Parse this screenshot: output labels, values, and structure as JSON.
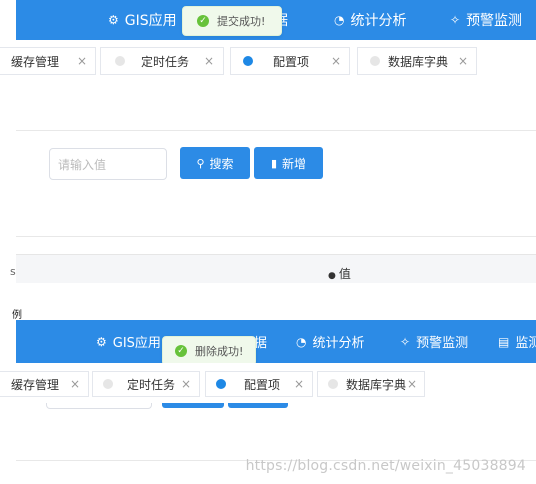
{
  "screen1": {
    "nav": [
      {
        "icon": "⚙",
        "label": "GIS应用"
      },
      {
        "icon": "",
        "label": "据"
      },
      {
        "icon": "◔",
        "label": "统计分析"
      },
      {
        "icon": "✧",
        "label": "预警监测"
      }
    ],
    "toast": "提交成功!",
    "tabs": [
      {
        "label": "缓存管理",
        "close": "×",
        "active": false
      },
      {
        "label": "定时任务",
        "close": "×",
        "active": false
      },
      {
        "label": "配置项",
        "close": "×",
        "active": true
      },
      {
        "label": "数据库字典",
        "close": "×",
        "active": false
      }
    ],
    "search_placeholder": "请输入值",
    "search_button": "搜索",
    "add_button": "新增",
    "table_header_left": "s",
    "table_header_value": "值",
    "table_header_value_icon": "●"
  },
  "separator_label": "例",
  "screen2": {
    "nav": [
      {
        "icon": "⚙",
        "label": "GIS应用"
      },
      {
        "icon": "",
        "label": "据"
      },
      {
        "icon": "◔",
        "label": "统计分析"
      },
      {
        "icon": "✧",
        "label": "预警监测"
      },
      {
        "icon": "▤",
        "label": "监测"
      }
    ],
    "toast": "删除成功!",
    "tabs": [
      {
        "label": "缓存管理",
        "close": "×",
        "active": false
      },
      {
        "label": "定时任务",
        "close": "×",
        "active": false
      },
      {
        "label": "配置项",
        "close": "×",
        "active": true
      },
      {
        "label": "数据库字典",
        "close": "×",
        "active": false
      }
    ]
  },
  "watermark": "https://blog.csdn.net/weixin_45038894",
  "colors": {
    "primary": "#2c8be6",
    "success": "#67c23a",
    "active_dot": "#1e88e5"
  }
}
